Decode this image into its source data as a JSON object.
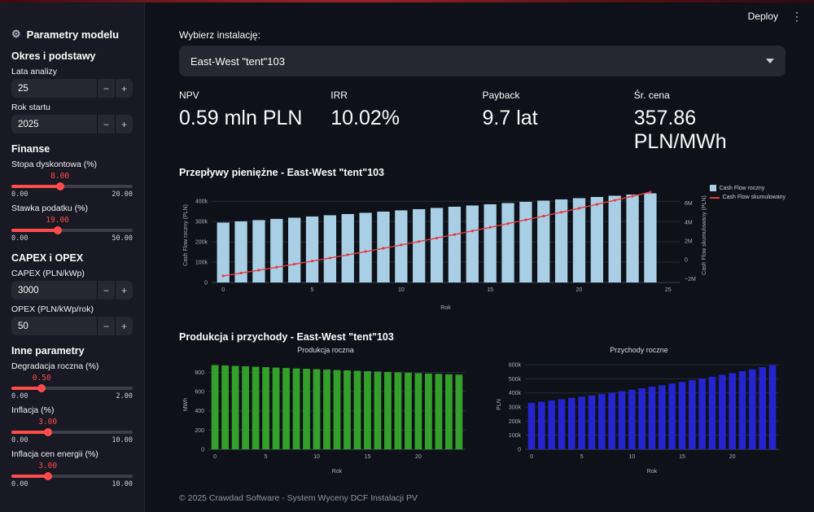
{
  "theme": {
    "accent": "#ff4b4b",
    "background": "#0e1117",
    "sidebar_background": "#181922",
    "widget_background": "#262730"
  },
  "glyphs": {
    "gear": "⚙",
    "kebab": "⋮",
    "minus": "−",
    "plus": "+"
  },
  "header": {
    "deploy_label": "Deploy"
  },
  "sidebar": {
    "title": "Parametry modelu",
    "section_okres": {
      "heading": "Okres i podstawy",
      "lata_analizy": {
        "label": "Lata analizy",
        "value": "25"
      },
      "rok_startu": {
        "label": "Rok startu",
        "value": "2025"
      }
    },
    "section_finanse": {
      "heading": "Finanse",
      "stopa_dyskontowa": {
        "label": "Stopa dyskontowa (%)",
        "value": "8.00",
        "min": "0.00",
        "max": "20.00"
      },
      "stawka_podatku": {
        "label": "Stawka podatku (%)",
        "value": "19.00",
        "min": "0.00",
        "max": "50.00"
      }
    },
    "section_capex": {
      "heading": "CAPEX i OPEX",
      "capex": {
        "label": "CAPEX (PLN/kWp)",
        "value": "3000"
      },
      "opex": {
        "label": "OPEX (PLN/kWp/rok)",
        "value": "50"
      }
    },
    "section_inne": {
      "heading": "Inne parametry",
      "degradacja": {
        "label": "Degradacja roczna (%)",
        "value": "0.50",
        "min": "0.00",
        "max": "2.00"
      },
      "inflacja": {
        "label": "Inflacja (%)",
        "value": "3.00",
        "min": "0.00",
        "max": "10.00"
      },
      "inflacja_energii": {
        "label": "Inflacja cen energii (%)",
        "value": "3.00",
        "min": "0.00",
        "max": "10.00"
      }
    }
  },
  "main": {
    "select_label": "Wybierz instalację:",
    "select_value": "East-West \"tent\"103",
    "metrics": [
      {
        "label": "NPV",
        "value": "0.59 mln PLN"
      },
      {
        "label": "IRR",
        "value": "10.02%"
      },
      {
        "label": "Payback",
        "value": "9.7 lat"
      },
      {
        "label": "Śr. cena",
        "value": "357.86 PLN/MWh"
      }
    ],
    "production_title": "Produkcja i przychody - East-West \"tent\"103",
    "footer": "© 2025 Crawdad Software - System Wyceny DCF Instalacji PV"
  },
  "chart_data": [
    {
      "type": "bar+line",
      "title": "Przepływy pieniężne - East-West \"tent\"103",
      "xlabel": "Rok",
      "x": [
        0,
        1,
        2,
        3,
        4,
        5,
        6,
        7,
        8,
        9,
        10,
        11,
        12,
        13,
        14,
        15,
        16,
        17,
        18,
        19,
        20,
        21,
        22,
        23,
        24
      ],
      "xticks": [
        0,
        5,
        10,
        15,
        20,
        25
      ],
      "bars": {
        "name": "Cash Flow roczny",
        "color": "#a8cfe6",
        "values": [
          295000,
          301000,
          307000,
          313000,
          319000,
          325000,
          331000,
          337000,
          343000,
          349000,
          355000,
          361000,
          367000,
          373000,
          379000,
          385000,
          391000,
          397000,
          403000,
          409000,
          415000,
          421000,
          427000,
          433000,
          439000
        ]
      },
      "line": {
        "name": "Cash Flow skumulowany",
        "color": "#e63b3b",
        "values": [
          -1705000,
          -1404000,
          -1097000,
          -784000,
          -465000,
          -140000,
          191000,
          528000,
          871000,
          1220000,
          1575000,
          1936000,
          2303000,
          2676000,
          3055000,
          3440000,
          3831000,
          4228000,
          4631000,
          5040000,
          5455000,
          5876000,
          6303000,
          6736000,
          7175000
        ]
      },
      "y_left": {
        "label": "Cash Flow roczny (PLN)",
        "range": [
          0,
          465000
        ],
        "ticks": [
          {
            "v": 0,
            "l": "0"
          },
          {
            "v": 100000,
            "l": "100k"
          },
          {
            "v": 200000,
            "l": "200k"
          },
          {
            "v": 300000,
            "l": "300k"
          },
          {
            "v": 400000,
            "l": "400k"
          }
        ]
      },
      "y_right": {
        "label": "Cash Flow skumulowany (PLN)",
        "range": [
          -2400000,
          7600000
        ],
        "ticks": [
          {
            "v": -2000000,
            "l": "−2M"
          },
          {
            "v": 0,
            "l": "0"
          },
          {
            "v": 2000000,
            "l": "2M"
          },
          {
            "v": 4000000,
            "l": "4M"
          },
          {
            "v": 6000000,
            "l": "6M"
          }
        ]
      },
      "legend_position": "top-right",
      "grid": true
    },
    {
      "type": "bar",
      "title": "Produkcja roczna",
      "xlabel": "Rok",
      "x": [
        0,
        1,
        2,
        3,
        4,
        5,
        6,
        7,
        8,
        9,
        10,
        11,
        12,
        13,
        14,
        15,
        16,
        17,
        18,
        19,
        20,
        21,
        22,
        23,
        24
      ],
      "xticks": [
        0,
        5,
        10,
        15,
        20
      ],
      "bars": {
        "name": "Produkcja roczna",
        "color": "#33a02c",
        "values": [
          875.0,
          870.6,
          866.3,
          861.9,
          857.6,
          853.3,
          849.1,
          844.8,
          840.6,
          836.4,
          832.2,
          828.0,
          823.9,
          819.8,
          815.7,
          811.6,
          807.5,
          803.5,
          799.5,
          795.5,
          791.5,
          787.6,
          783.6,
          779.7,
          775.8
        ]
      },
      "y_left": {
        "label": "MWh",
        "range": [
          0,
          930
        ],
        "ticks": [
          {
            "v": 0,
            "l": "0"
          },
          {
            "v": 200,
            "l": "200"
          },
          {
            "v": 400,
            "l": "400"
          },
          {
            "v": 600,
            "l": "600"
          },
          {
            "v": 800,
            "l": "800"
          }
        ]
      },
      "grid": true
    },
    {
      "type": "bar",
      "title": "Przychody roczne",
      "xlabel": "Rok",
      "x": [
        0,
        1,
        2,
        3,
        4,
        5,
        6,
        7,
        8,
        9,
        10,
        11,
        12,
        13,
        14,
        15,
        16,
        17,
        18,
        19,
        20,
        21,
        22,
        23,
        24
      ],
      "xticks": [
        0,
        5,
        10,
        15,
        20
      ],
      "bars": {
        "name": "Przychody roczne",
        "color": "#2525cf",
        "values": [
          330000,
          338300,
          346700,
          355400,
          364300,
          373400,
          382700,
          392300,
          402100,
          412100,
          422400,
          433000,
          443800,
          454900,
          466300,
          477900,
          489900,
          502100,
          514700,
          527500,
          540700,
          554200,
          568100,
          582300,
          596900
        ]
      },
      "y_left": {
        "label": "PLN",
        "range": [
          0,
          635000
        ],
        "ticks": [
          {
            "v": 0,
            "l": "0"
          },
          {
            "v": 100000,
            "l": "100k"
          },
          {
            "v": 200000,
            "l": "200k"
          },
          {
            "v": 300000,
            "l": "300k"
          },
          {
            "v": 400000,
            "l": "400k"
          },
          {
            "v": 500000,
            "l": "500k"
          },
          {
            "v": 600000,
            "l": "600k"
          }
        ]
      },
      "grid": true
    }
  ]
}
